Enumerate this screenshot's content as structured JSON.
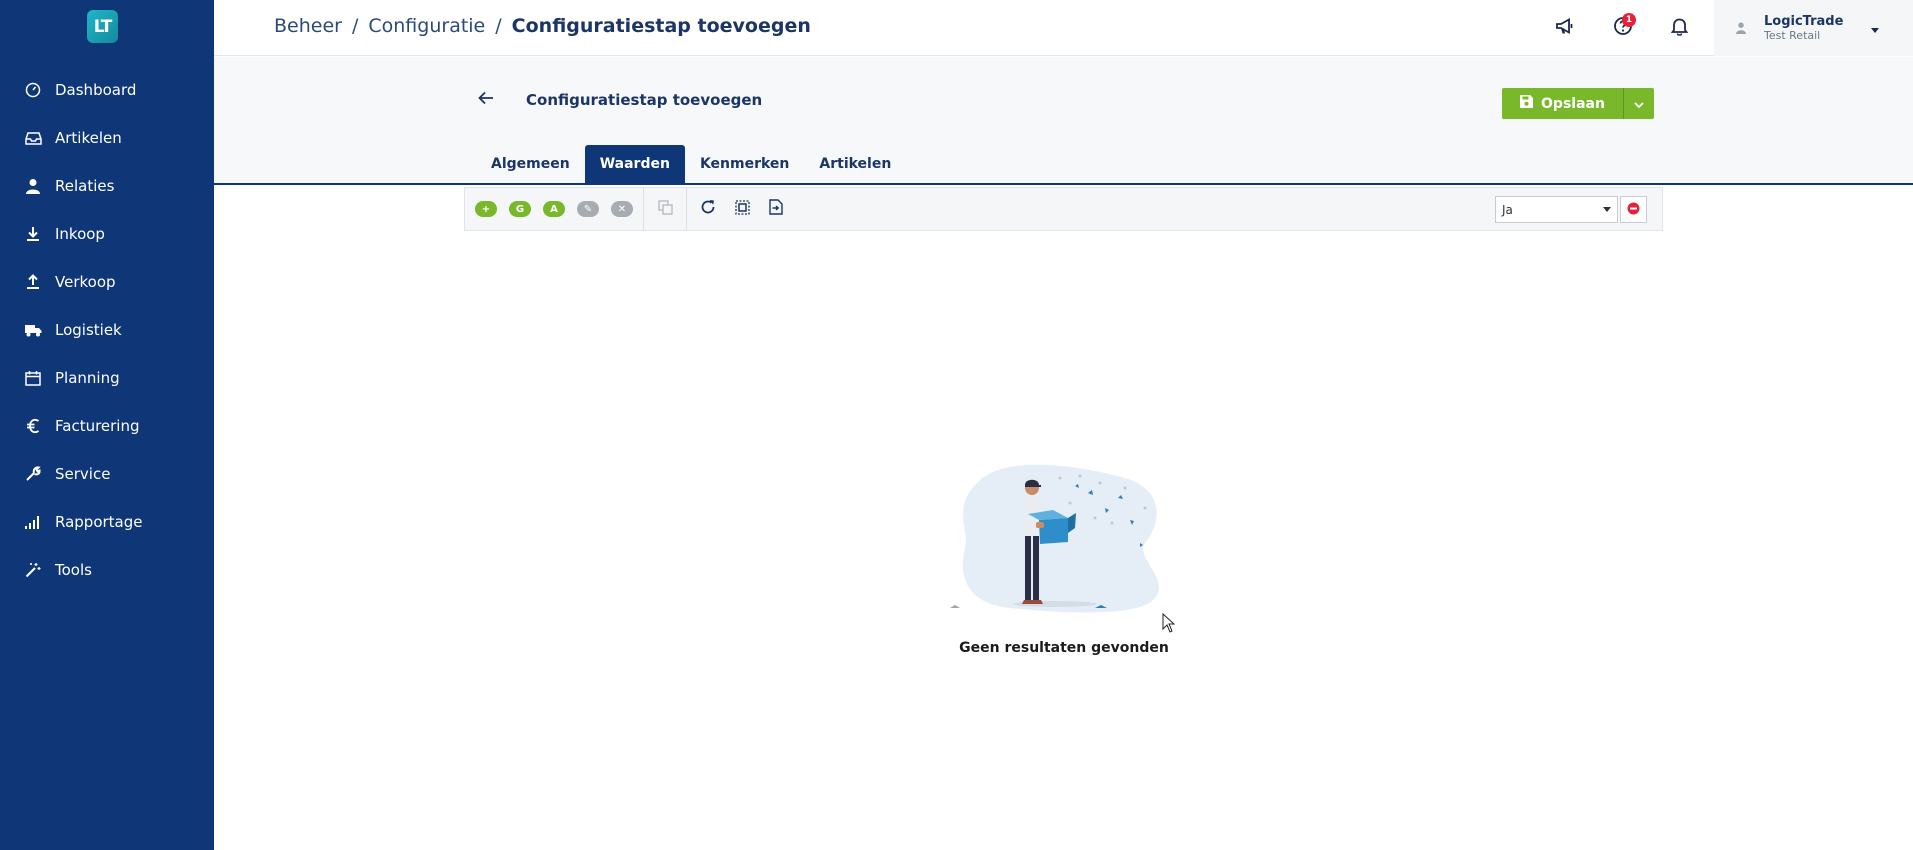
{
  "app": {
    "logo_text": "LT"
  },
  "sidebar": {
    "items": [
      {
        "label": "Dashboard",
        "icon": "gauge-icon"
      },
      {
        "label": "Artikelen",
        "icon": "inbox-icon"
      },
      {
        "label": "Relaties",
        "icon": "user-icon"
      },
      {
        "label": "Inkoop",
        "icon": "download-icon"
      },
      {
        "label": "Verkoop",
        "icon": "upload-icon"
      },
      {
        "label": "Logistiek",
        "icon": "truck-icon"
      },
      {
        "label": "Planning",
        "icon": "calendar-icon"
      },
      {
        "label": "Facturering",
        "icon": "euro-icon"
      },
      {
        "label": "Service",
        "icon": "wrench-icon"
      },
      {
        "label": "Rapportage",
        "icon": "signal-bars-icon"
      },
      {
        "label": "Tools",
        "icon": "magic-wand-icon"
      }
    ]
  },
  "header": {
    "breadcrumb": [
      "Beheer",
      "Configuratie",
      "Configuratiestap toevoegen"
    ],
    "separator": "/",
    "notification_badge": "1",
    "user": {
      "name": "LogicTrade",
      "company": "Test Retail"
    }
  },
  "page": {
    "title": "Configuratiestap toevoegen",
    "save_label": "Opslaan",
    "tabs": [
      {
        "label": "Algemeen",
        "active": false
      },
      {
        "label": "Waarden",
        "active": true
      },
      {
        "label": "Kenmerken",
        "active": false
      },
      {
        "label": "Artikelen",
        "active": false
      }
    ]
  },
  "toolbar": {
    "pills": [
      {
        "label": "+",
        "color": "#78b82a",
        "name": "add-button"
      },
      {
        "label": "G",
        "color": "#78b82a",
        "name": "g-button"
      },
      {
        "label": "A",
        "color": "#78b82a",
        "name": "a-button"
      },
      {
        "label": "✎",
        "color": "#a7acb3",
        "name": "edit-button"
      },
      {
        "label": "✕",
        "color": "#a7acb3",
        "name": "delete-button"
      }
    ],
    "filter_value": "Ja"
  },
  "empty_state": {
    "message": "Geen resultaten gevonden"
  },
  "colors": {
    "sidebar": "#0f3677",
    "accent_green": "#78b82a",
    "badge_red": "#e6213a"
  }
}
